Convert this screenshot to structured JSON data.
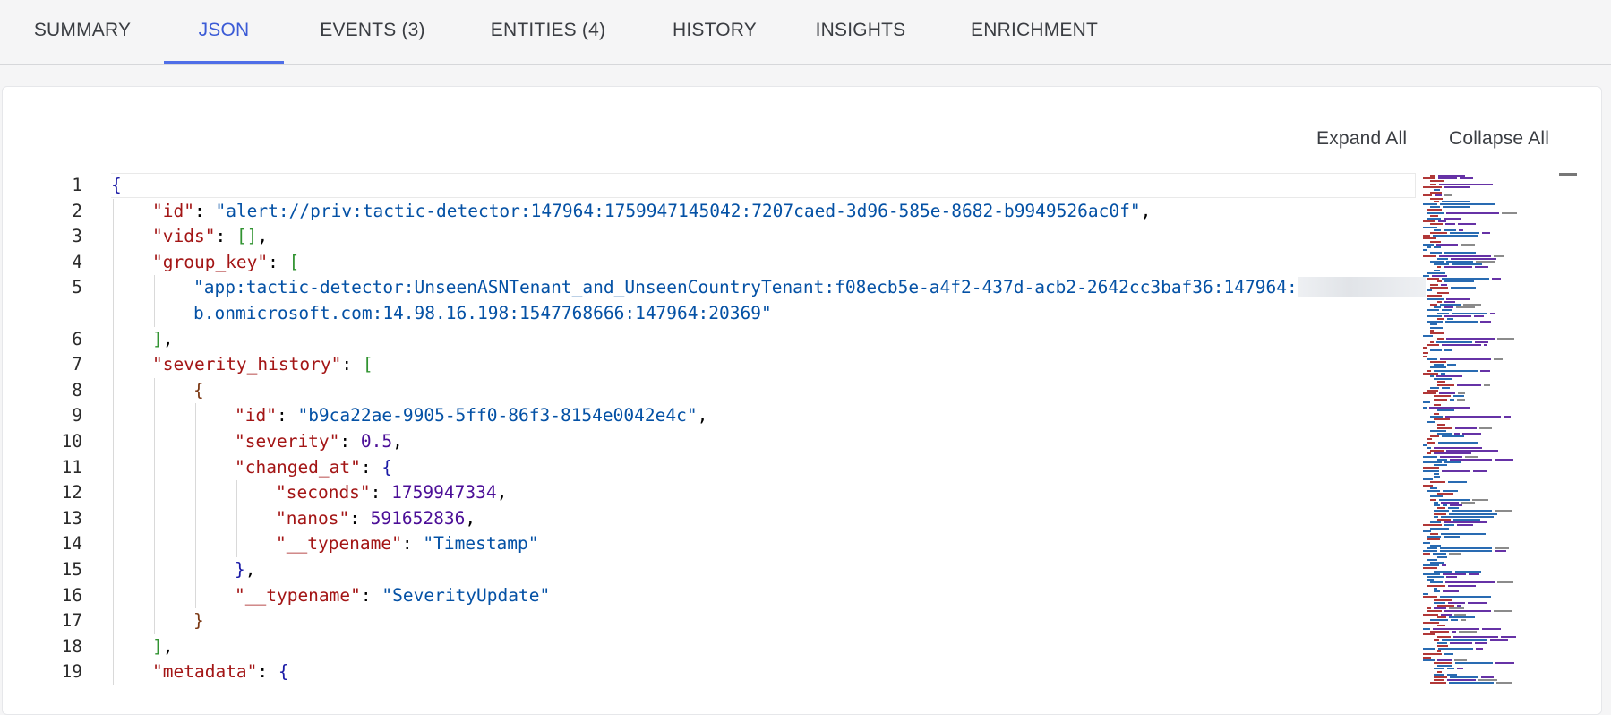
{
  "tabs": [
    {
      "label": "SUMMARY",
      "active": false
    },
    {
      "label": "JSON",
      "active": true
    },
    {
      "label": "EVENTS (3)",
      "active": false
    },
    {
      "label": "ENTITIES (4)",
      "active": false
    },
    {
      "label": "HISTORY",
      "active": false
    },
    {
      "label": "INSIGHTS",
      "active": false
    },
    {
      "label": "ENRICHMENT",
      "active": false
    }
  ],
  "toolbar": {
    "expand_all": "Expand All",
    "collapse_all": "Collapse All"
  },
  "editor": {
    "line_numbers": [
      "1",
      "2",
      "3",
      "4",
      "5",
      "",
      "6",
      "7",
      "8",
      "9",
      "10",
      "11",
      "12",
      "13",
      "14",
      "15",
      "16",
      "17",
      "18",
      "19"
    ],
    "lines": [
      {
        "indent": 0,
        "tokens": [
          {
            "t": "{",
            "c": "b1"
          }
        ]
      },
      {
        "indent": 1,
        "tokens": [
          {
            "t": "\"id\"",
            "c": "k"
          },
          {
            "t": ": ",
            "c": "p"
          },
          {
            "t": "\"alert://priv:tactic-detector:147964:1759947145042:7207caed-3d96-585e-8682-b9949526ac0f\"",
            "c": "s"
          },
          {
            "t": ",",
            "c": "p"
          }
        ]
      },
      {
        "indent": 1,
        "tokens": [
          {
            "t": "\"vids\"",
            "c": "k"
          },
          {
            "t": ": ",
            "c": "p"
          },
          {
            "t": "[]",
            "c": "b2"
          },
          {
            "t": ",",
            "c": "p"
          }
        ]
      },
      {
        "indent": 1,
        "tokens": [
          {
            "t": "\"group_key\"",
            "c": "k"
          },
          {
            "t": ": ",
            "c": "p"
          },
          {
            "t": "[",
            "c": "b2"
          }
        ]
      },
      {
        "indent": 2,
        "tokens": [
          {
            "t": "\"app:tactic-detector:UnseenASNTenant_and_UnseenCountryTenant:f08ecb5e-a4f2-437d-acb2-2642cc3baf36:147964:",
            "c": "s"
          }
        ],
        "redacted": true
      },
      {
        "indent": 2,
        "tokens": [
          {
            "t": "b.onmicrosoft.com:14.98.16.198:1547768666:147964:20369\"",
            "c": "s"
          }
        ]
      },
      {
        "indent": 1,
        "tokens": [
          {
            "t": "]",
            "c": "b2"
          },
          {
            "t": ",",
            "c": "p"
          }
        ]
      },
      {
        "indent": 1,
        "tokens": [
          {
            "t": "\"severity_history\"",
            "c": "k"
          },
          {
            "t": ": ",
            "c": "p"
          },
          {
            "t": "[",
            "c": "b2"
          }
        ]
      },
      {
        "indent": 2,
        "tokens": [
          {
            "t": "{",
            "c": "b3"
          }
        ]
      },
      {
        "indent": 3,
        "tokens": [
          {
            "t": "\"id\"",
            "c": "k"
          },
          {
            "t": ": ",
            "c": "p"
          },
          {
            "t": "\"b9ca22ae-9905-5ff0-86f3-8154e0042e4c\"",
            "c": "s"
          },
          {
            "t": ",",
            "c": "p"
          }
        ]
      },
      {
        "indent": 3,
        "tokens": [
          {
            "t": "\"severity\"",
            "c": "k"
          },
          {
            "t": ": ",
            "c": "p"
          },
          {
            "t": "0.5",
            "c": "n"
          },
          {
            "t": ",",
            "c": "p"
          }
        ]
      },
      {
        "indent": 3,
        "tokens": [
          {
            "t": "\"changed_at\"",
            "c": "k"
          },
          {
            "t": ": ",
            "c": "p"
          },
          {
            "t": "{",
            "c": "b1"
          }
        ]
      },
      {
        "indent": 4,
        "tokens": [
          {
            "t": "\"seconds\"",
            "c": "k"
          },
          {
            "t": ": ",
            "c": "p"
          },
          {
            "t": "1759947334",
            "c": "n"
          },
          {
            "t": ",",
            "c": "p"
          }
        ]
      },
      {
        "indent": 4,
        "tokens": [
          {
            "t": "\"nanos\"",
            "c": "k"
          },
          {
            "t": ": ",
            "c": "p"
          },
          {
            "t": "591652836",
            "c": "n"
          },
          {
            "t": ",",
            "c": "p"
          }
        ]
      },
      {
        "indent": 4,
        "tokens": [
          {
            "t": "\"__typename\"",
            "c": "k"
          },
          {
            "t": ": ",
            "c": "p"
          },
          {
            "t": "\"Timestamp\"",
            "c": "s"
          }
        ]
      },
      {
        "indent": 3,
        "tokens": [
          {
            "t": "}",
            "c": "b1"
          },
          {
            "t": ",",
            "c": "p"
          }
        ]
      },
      {
        "indent": 3,
        "tokens": [
          {
            "t": "\"__typename\"",
            "c": "k"
          },
          {
            "t": ": ",
            "c": "p"
          },
          {
            "t": "\"SeverityUpdate\"",
            "c": "s"
          }
        ]
      },
      {
        "indent": 2,
        "tokens": [
          {
            "t": "}",
            "c": "b3"
          }
        ]
      },
      {
        "indent": 1,
        "tokens": [
          {
            "t": "]",
            "c": "b2"
          },
          {
            "t": ",",
            "c": "p"
          }
        ]
      },
      {
        "indent": 1,
        "tokens": [
          {
            "t": "\"metadata\"",
            "c": "k"
          },
          {
            "t": ": ",
            "c": "p"
          },
          {
            "t": "{",
            "c": "b1"
          }
        ]
      }
    ]
  },
  "colors": {
    "accent": "#4f6ee8",
    "key": "#a31515",
    "string": "#0451a5",
    "number": "#4b0e97"
  }
}
